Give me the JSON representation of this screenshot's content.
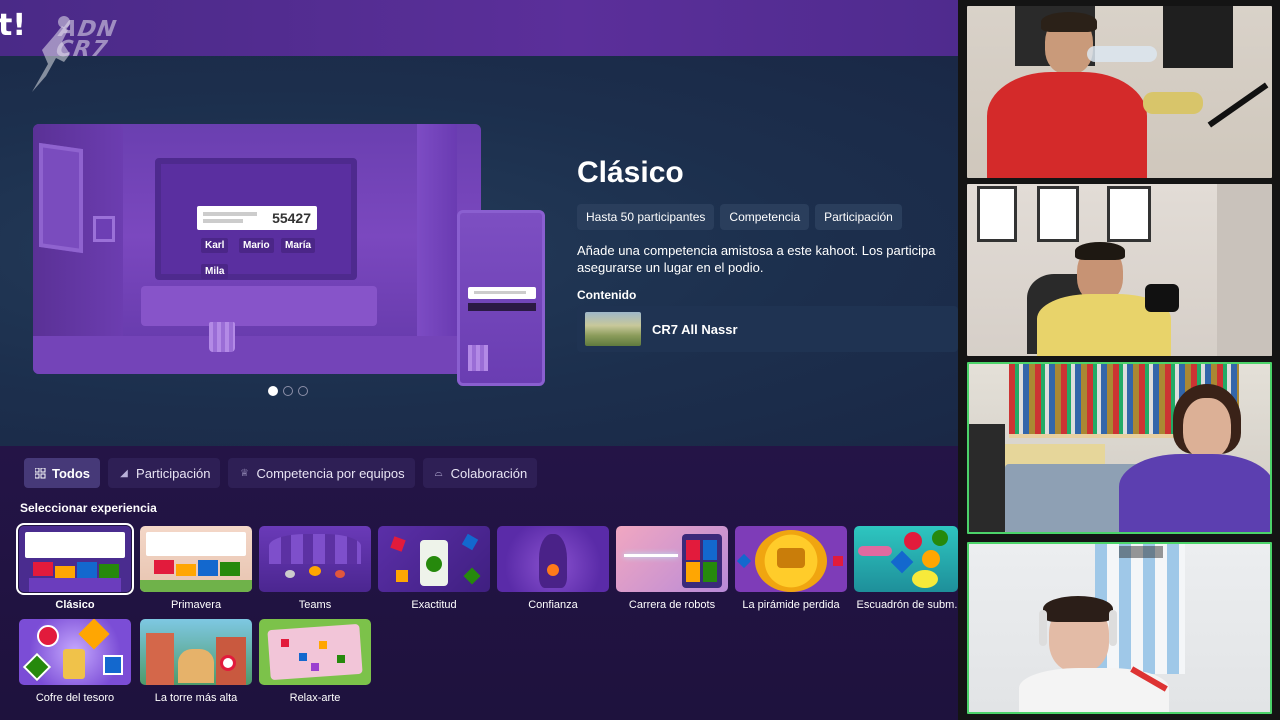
{
  "watermark": {
    "text": "ADN CR7"
  },
  "topbar": {
    "logo_fragment": "t!"
  },
  "preview": {
    "score": "55427",
    "names": [
      "Karl",
      "Mario",
      "María",
      "Mila"
    ],
    "carousel": {
      "count": 3,
      "active": 1
    }
  },
  "detail": {
    "title": "Clásico",
    "tags": [
      "Hasta 50 participantes",
      "Competencia",
      "Participación"
    ],
    "description_line1": "Añade una competencia amistosa a este kahoot. Los participa",
    "description_line2": "asegurarse un lugar en el podio.",
    "content_label": "Contenido",
    "content_title": "CR7 All Nassr"
  },
  "tabs": [
    {
      "label": "Todos",
      "icon": "grid-icon",
      "active": true
    },
    {
      "label": "Participación",
      "icon": "megaphone-icon",
      "active": false
    },
    {
      "label": "Competencia por equipos",
      "icon": "trophy-icon",
      "active": false
    },
    {
      "label": "Colaboración",
      "icon": "handshake-icon",
      "active": false
    }
  ],
  "select_label": "Seleccionar experiencia",
  "experiences": [
    {
      "label": "Clásico",
      "selected": true
    },
    {
      "label": "Primavera",
      "selected": false
    },
    {
      "label": "Teams",
      "selected": false
    },
    {
      "label": "Exactitud",
      "selected": false
    },
    {
      "label": "Confianza",
      "selected": false
    },
    {
      "label": "Carrera de robots",
      "selected": false
    },
    {
      "label": "La pirámide perdida",
      "selected": false
    },
    {
      "label": "Escuadrón de subm...",
      "selected": false
    },
    {
      "label": "Cofre del tesoro",
      "selected": false
    },
    {
      "label": "La torre más alta",
      "selected": false
    },
    {
      "label": "Relax-arte",
      "selected": false
    }
  ],
  "video_tiles": [
    {
      "id": "participant-1",
      "speaking": false
    },
    {
      "id": "participant-2",
      "speaking": false
    },
    {
      "id": "participant-3",
      "speaking": true
    },
    {
      "id": "participant-4",
      "speaking": true
    }
  ],
  "colors": {
    "accent_purple": "#463978",
    "speaking_green": "#4cd36a",
    "hero_bg": "#1c2f4d"
  }
}
